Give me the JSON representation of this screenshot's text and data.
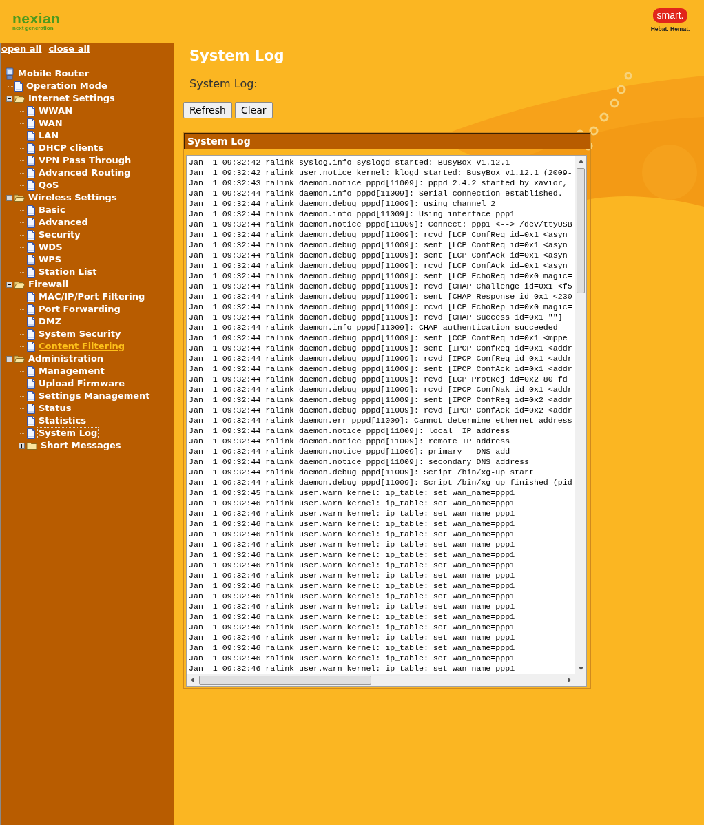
{
  "header": {
    "brand": "nexian",
    "brand_tagline": "next generation",
    "partner": "smart.",
    "partner_tagline": "Hebat. Hemat."
  },
  "sidebar": {
    "links": [
      "open all",
      "close all"
    ],
    "tree": {
      "label": "Mobile Router",
      "kind": "root",
      "children": [
        {
          "label": "Operation Mode",
          "kind": "page",
          "selected": false,
          "hover": false
        },
        {
          "label": "Internet Settings",
          "kind": "folder",
          "expanded": true,
          "selected": false,
          "hover": false,
          "children": [
            {
              "label": "WWAN",
              "kind": "page",
              "selected": false,
              "hover": false
            },
            {
              "label": "WAN",
              "kind": "page",
              "selected": false,
              "hover": false
            },
            {
              "label": "LAN",
              "kind": "page",
              "selected": false,
              "hover": false
            },
            {
              "label": "DHCP clients",
              "kind": "page",
              "selected": false,
              "hover": false
            },
            {
              "label": "VPN Pass Through",
              "kind": "page",
              "selected": false,
              "hover": false
            },
            {
              "label": "Advanced Routing",
              "kind": "page",
              "selected": false,
              "hover": false
            },
            {
              "label": "QoS",
              "kind": "page",
              "selected": false,
              "hover": false
            }
          ]
        },
        {
          "label": "Wireless Settings",
          "kind": "folder",
          "expanded": true,
          "selected": false,
          "hover": false,
          "children": [
            {
              "label": "Basic",
              "kind": "page",
              "selected": false,
              "hover": false
            },
            {
              "label": "Advanced",
              "kind": "page",
              "selected": false,
              "hover": false
            },
            {
              "label": "Security",
              "kind": "page",
              "selected": false,
              "hover": false
            },
            {
              "label": "WDS",
              "kind": "page",
              "selected": false,
              "hover": false
            },
            {
              "label": "WPS",
              "kind": "page",
              "selected": false,
              "hover": false
            },
            {
              "label": "Station List",
              "kind": "page",
              "selected": false,
              "hover": false
            }
          ]
        },
        {
          "label": "Firewall",
          "kind": "folder",
          "expanded": true,
          "selected": false,
          "hover": false,
          "children": [
            {
              "label": "MAC/IP/Port Filtering",
              "kind": "page",
              "selected": false,
              "hover": false
            },
            {
              "label": "Port Forwarding",
              "kind": "page",
              "selected": false,
              "hover": false
            },
            {
              "label": "DMZ",
              "kind": "page",
              "selected": false,
              "hover": false
            },
            {
              "label": "System Security",
              "kind": "page",
              "selected": false,
              "hover": false
            },
            {
              "label": "Content Filtering",
              "kind": "page",
              "selected": false,
              "hover": true
            }
          ]
        },
        {
          "label": "Administration",
          "kind": "folder",
          "expanded": true,
          "selected": false,
          "hover": false,
          "children": [
            {
              "label": "Management",
              "kind": "page",
              "selected": false,
              "hover": false
            },
            {
              "label": "Upload Firmware",
              "kind": "page",
              "selected": false,
              "hover": false
            },
            {
              "label": "Settings Management",
              "kind": "page",
              "selected": false,
              "hover": false
            },
            {
              "label": "Status",
              "kind": "page",
              "selected": false,
              "hover": false
            },
            {
              "label": "Statistics",
              "kind": "page",
              "selected": false,
              "hover": false
            },
            {
              "label": "System Log",
              "kind": "page",
              "selected": true,
              "hover": false
            },
            {
              "label": "Short Messages",
              "kind": "folder",
              "expanded": false,
              "selected": false,
              "hover": false
            }
          ]
        }
      ]
    }
  },
  "page": {
    "title": "System Log",
    "label": "System Log:",
    "buttons": [
      "Refresh",
      "Clear"
    ]
  },
  "log_panel": {
    "title": "System Log",
    "lines": [
      "Jan  1 09:32:42 ralink syslog.info syslogd started: BusyBox v1.12.1",
      "Jan  1 09:32:42 ralink user.notice kernel: klogd started: BusyBox v1.12.1 (2009-",
      "Jan  1 09:32:43 ralink daemon.notice pppd[11009]: pppd 2.4.2 started by xavior,",
      "Jan  1 09:32:44 ralink daemon.info pppd[11009]: Serial connection established.",
      "Jan  1 09:32:44 ralink daemon.debug pppd[11009]: using channel 2",
      "Jan  1 09:32:44 ralink daemon.info pppd[11009]: Using interface ppp1",
      "Jan  1 09:32:44 ralink daemon.notice pppd[11009]: Connect: ppp1 <--> /dev/ttyUSB",
      "Jan  1 09:32:44 ralink daemon.debug pppd[11009]: rcvd [LCP ConfReq id=0x1 <asyn",
      "Jan  1 09:32:44 ralink daemon.debug pppd[11009]: sent [LCP ConfReq id=0x1 <asyn",
      "Jan  1 09:32:44 ralink daemon.debug pppd[11009]: sent [LCP ConfAck id=0x1 <asyn",
      "Jan  1 09:32:44 ralink daemon.debug pppd[11009]: rcvd [LCP ConfAck id=0x1 <asyn",
      "Jan  1 09:32:44 ralink daemon.debug pppd[11009]: sent [LCP EchoReq id=0x0 magic=",
      "Jan  1 09:32:44 ralink daemon.debug pppd[11009]: rcvd [CHAP Challenge id=0x1 <f5",
      "Jan  1 09:32:44 ralink daemon.debug pppd[11009]: sent [CHAP Response id=0x1 <230",
      "Jan  1 09:32:44 ralink daemon.debug pppd[11009]: rcvd [LCP EchoRep id=0x0 magic=",
      "Jan  1 09:32:44 ralink daemon.debug pppd[11009]: rcvd [CHAP Success id=0x1 \"\"]",
      "Jan  1 09:32:44 ralink daemon.info pppd[11009]: CHAP authentication succeeded",
      "Jan  1 09:32:44 ralink daemon.debug pppd[11009]: sent [CCP ConfReq id=0x1 <mppe",
      "Jan  1 09:32:44 ralink daemon.debug pppd[11009]: sent [IPCP ConfReq id=0x1 <addr",
      "Jan  1 09:32:44 ralink daemon.debug pppd[11009]: rcvd [IPCP ConfReq id=0x1 <addr",
      "Jan  1 09:32:44 ralink daemon.debug pppd[11009]: sent [IPCP ConfAck id=0x1 <addr",
      "Jan  1 09:32:44 ralink daemon.debug pppd[11009]: rcvd [LCP ProtRej id=0x2 80 fd",
      "Jan  1 09:32:44 ralink daemon.debug pppd[11009]: rcvd [IPCP ConfNak id=0x1 <addr",
      "Jan  1 09:32:44 ralink daemon.debug pppd[11009]: sent [IPCP ConfReq id=0x2 <addr",
      "Jan  1 09:32:44 ralink daemon.debug pppd[11009]: rcvd [IPCP ConfAck id=0x2 <addr",
      "Jan  1 09:32:44 ralink daemon.err pppd[11009]: Cannot determine ethernet address",
      "Jan  1 09:32:44 ralink daemon.notice pppd[11009]: local  IP address",
      "Jan  1 09:32:44 ralink daemon.notice pppd[11009]: remote IP address",
      "Jan  1 09:32:44 ralink daemon.notice pppd[11009]: primary   DNS add",
      "Jan  1 09:32:44 ralink daemon.notice pppd[11009]: secondary DNS address",
      "Jan  1 09:32:44 ralink daemon.debug pppd[11009]: Script /bin/xg-up start",
      "Jan  1 09:32:44 ralink daemon.debug pppd[11009]: Script /bin/xg-up finished (pid",
      "Jan  1 09:32:45 ralink user.warn kernel: ip_table: set wan_name=ppp1",
      "Jan  1 09:32:46 ralink user.warn kernel: ip_table: set wan_name=ppp1",
      "Jan  1 09:32:46 ralink user.warn kernel: ip_table: set wan_name=ppp1",
      "Jan  1 09:32:46 ralink user.warn kernel: ip_table: set wan_name=ppp1",
      "Jan  1 09:32:46 ralink user.warn kernel: ip_table: set wan_name=ppp1",
      "Jan  1 09:32:46 ralink user.warn kernel: ip_table: set wan_name=ppp1",
      "Jan  1 09:32:46 ralink user.warn kernel: ip_table: set wan_name=ppp1",
      "Jan  1 09:32:46 ralink user.warn kernel: ip_table: set wan_name=ppp1",
      "Jan  1 09:32:46 ralink user.warn kernel: ip_table: set wan_name=ppp1",
      "Jan  1 09:32:46 ralink user.warn kernel: ip_table: set wan_name=ppp1",
      "Jan  1 09:32:46 ralink user.warn kernel: ip_table: set wan_name=ppp1",
      "Jan  1 09:32:46 ralink user.warn kernel: ip_table: set wan_name=ppp1",
      "Jan  1 09:32:46 ralink user.warn kernel: ip_table: set wan_name=ppp1",
      "Jan  1 09:32:46 ralink user.warn kernel: ip_table: set wan_name=ppp1",
      "Jan  1 09:32:46 ralink user.warn kernel: ip_table: set wan_name=ppp1",
      "Jan  1 09:32:46 ralink user.warn kernel: ip_table: set wan_name=ppp1",
      "Jan  1 09:32:46 ralink user.warn kernel: ip_table: set wan_name=ppp1",
      "Jan  1 09:32:46 ralink user.warn kernel: ip_table: set wan_name=ppp1"
    ]
  }
}
